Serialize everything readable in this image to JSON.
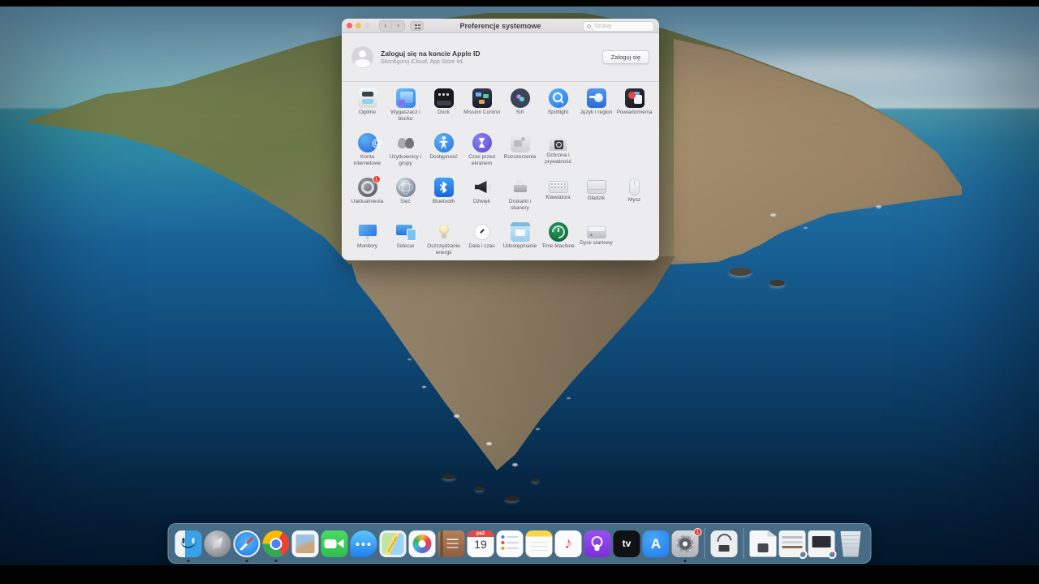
{
  "colors": {
    "accent_blue": "#1f7ae8",
    "badge_red": "#ee3b30",
    "window_bg": "#ececef",
    "dock_bg": "rgba(84,122,149,0.85)",
    "ocean_deep": "#0a3a61",
    "sky": "#8fb9cd"
  },
  "window": {
    "title": "Preferencje systemowe",
    "search_placeholder": "Szukaj",
    "apple_id": {
      "title": "Zaloguj się na koncie Apple ID",
      "subtitle": "Skonfiguruj iCloud, App Store itd.",
      "button": "Zaloguj się"
    },
    "pref_rows": [
      {
        "items": [
          {
            "id": "general",
            "label": "Ogólne"
          },
          {
            "id": "desktop",
            "label": "Wygaszacz i biurko"
          },
          {
            "id": "dock",
            "label": "Dock"
          },
          {
            "id": "mission",
            "label": "Mission Control"
          },
          {
            "id": "siri",
            "label": "Siri"
          },
          {
            "id": "spotlight",
            "label": "Spotlight"
          },
          {
            "id": "language",
            "label": "Język i region"
          },
          {
            "id": "notifications",
            "label": "Powiadomienia"
          }
        ]
      },
      {
        "items": [
          {
            "id": "internet",
            "label": "Konta internetowe"
          },
          {
            "id": "users",
            "label": "Użytkownicy i grupy"
          },
          {
            "id": "accessibility",
            "label": "Dostępność"
          },
          {
            "id": "screentime",
            "label": "Czas przed ekranem"
          },
          {
            "id": "extensions",
            "label": "Rozszerzenia"
          },
          {
            "id": "security",
            "label": "Ochrona i prywatność"
          }
        ]
      },
      {
        "items": [
          {
            "id": "update",
            "label": "Uaktualnienia",
            "badge": "1"
          },
          {
            "id": "network",
            "label": "Sieć"
          },
          {
            "id": "bluetooth",
            "label": "Bluetooth"
          },
          {
            "id": "sound",
            "label": "Dźwięk"
          },
          {
            "id": "printers",
            "label": "Drukarki i skanery"
          },
          {
            "id": "keyboard",
            "label": "Klawiatura"
          },
          {
            "id": "trackpad",
            "label": "Gładzik"
          },
          {
            "id": "mouse",
            "label": "Mysz"
          }
        ]
      },
      {
        "items": [
          {
            "id": "displays",
            "label": "Monitory"
          },
          {
            "id": "sidecar",
            "label": "Sidecar"
          },
          {
            "id": "energy",
            "label": "Oszczędzanie energii"
          },
          {
            "id": "datetime",
            "label": "Data i czas"
          },
          {
            "id": "sharing",
            "label": "Udostępnianie"
          },
          {
            "id": "timemachine",
            "label": "Time Machine"
          },
          {
            "id": "startup",
            "label": "Dysk startowy"
          }
        ]
      }
    ]
  },
  "dock": {
    "items": [
      {
        "id": "finder",
        "indicator": true
      },
      {
        "id": "launchpad"
      },
      {
        "id": "safari",
        "indicator": true
      },
      {
        "id": "chrome",
        "indicator": true
      },
      {
        "id": "preview"
      },
      {
        "id": "facetime"
      },
      {
        "id": "messages"
      },
      {
        "id": "maps"
      },
      {
        "id": "photos"
      },
      {
        "id": "contacts"
      },
      {
        "id": "calendar",
        "month": "paź",
        "day": "19"
      },
      {
        "id": "reminders"
      },
      {
        "id": "notes"
      },
      {
        "id": "music"
      },
      {
        "id": "podcasts"
      },
      {
        "id": "tv"
      },
      {
        "id": "appstore"
      },
      {
        "id": "sysprefs",
        "badge": "1",
        "indicator": true
      },
      {
        "type": "divider"
      },
      {
        "id": "hwtool"
      },
      {
        "type": "divider"
      },
      {
        "id": "document"
      },
      {
        "id": "chromewin1",
        "minibadge": true
      },
      {
        "id": "chromewin2",
        "minibadge": true
      },
      {
        "id": "trash"
      }
    ]
  }
}
